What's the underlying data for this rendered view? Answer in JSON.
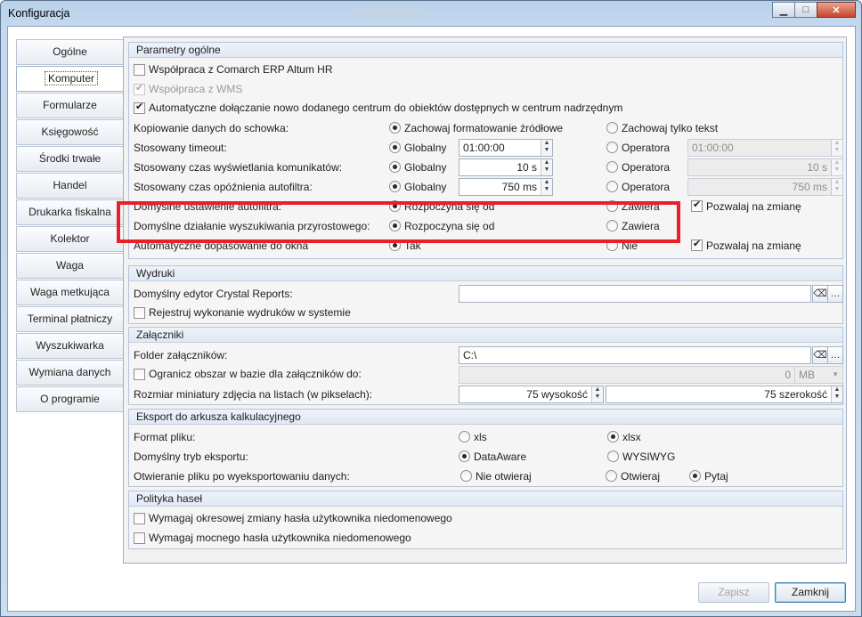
{
  "window": {
    "title": "Konfiguracja"
  },
  "tabs": [
    {
      "label": "Ogólne"
    },
    {
      "label": "Komputer"
    },
    {
      "label": "Formularze"
    },
    {
      "label": "Księgowość"
    },
    {
      "label": "Środki trwałe"
    },
    {
      "label": "Handel"
    },
    {
      "label": "Drukarka fiskalna"
    },
    {
      "label": "Kolektor"
    },
    {
      "label": "Waga"
    },
    {
      "label": "Waga metkująca"
    },
    {
      "label": "Terminal płatniczy"
    },
    {
      "label": "Wyszukiwarka"
    },
    {
      "label": "Wymiana danych"
    },
    {
      "label": "O programie"
    }
  ],
  "general": {
    "title": "Parametry ogólne",
    "erp_altum": "Współpraca z Comarch ERP Altum HR",
    "wms": "Współpraca z WMS",
    "auto_attach": "Automatyczne dołączanie nowo dodanego centrum do obiektów dostępnych w centrum nadrzędnym",
    "copy_label": "Kopiowanie danych do schowka:",
    "copy_opt1": "Zachowaj formatowanie źródłowe",
    "copy_opt2": "Zachowaj tylko tekst",
    "timeout_label": "Stosowany timeout:",
    "msg_label": "Stosowany czas wyświetlania komunikatów:",
    "delay_label": "Stosowany czas opóźnienia autofiltra:",
    "global": "Globalny",
    "operator": "Operatora",
    "timeout_global": "01:00:00",
    "timeout_operator": "01:00:00",
    "msg_global": "10 s",
    "msg_operator": "10 s",
    "delay_global": "750 ms",
    "delay_operator": "750 ms",
    "autofilter_label": "Domyślne ustawienie autofiltra:",
    "autofilter_opt1": "Rozpoczyna się od",
    "autofilter_opt2": "Zawiera",
    "allow_change": "Pozwalaj na zmianę",
    "incremental_label": "Domyślne działanie wyszukiwania przyrostowego:",
    "incremental_opt1": "Rozpoczyna się od",
    "incremental_opt2": "Zawiera",
    "autofit_label": "Automatyczne dopasowanie do okna",
    "autofit_opt1": "Tak",
    "autofit_opt2": "Nie",
    "allow_change2": "Pozwalaj na zmianę"
  },
  "prints": {
    "title": "Wydruki",
    "editor_label": "Domyślny edytor Crystal Reports:",
    "editor_value": "",
    "register_label": "Rejestruj wykonanie wydruków w systemie"
  },
  "attachments": {
    "title": "Załączniki",
    "folder_label": "Folder załączników:",
    "folder_value": "C:\\",
    "limit_label": "Ogranicz obszar w bazie dla załączników do:",
    "limit_value": "0",
    "limit_unit": "MB",
    "thumb_label": "Rozmiar miniatury zdjęcia na listach (w pikselach):",
    "thumb_height": "75 wysokość",
    "thumb_width": "75 szerokość"
  },
  "export": {
    "title": "Eksport do arkusza kalkulacyjnego",
    "format_label": "Format pliku:",
    "format_xls": "xls",
    "format_xlsx": "xlsx",
    "mode_label": "Domyślny tryb eksportu:",
    "mode_dataaware": "DataAware",
    "mode_wysiwyg": "WYSIWYG",
    "open_label": "Otwieranie pliku po wyeksportowaniu danych:",
    "open_no": "Nie otwieraj",
    "open_yes": "Otwieraj",
    "open_ask": "Pytaj"
  },
  "password": {
    "title": "Polityka haseł",
    "periodic": "Wymagaj okresowej zmiany hasła użytkownika niedomenowego",
    "strong": "Wymagaj mocnego hasła użytkownika niedomenowego"
  },
  "footer": {
    "save": "Zapisz",
    "close": "Zamknij"
  },
  "colors": {
    "highlight": "#e8202a",
    "window_bg": "#c9dcf0"
  }
}
